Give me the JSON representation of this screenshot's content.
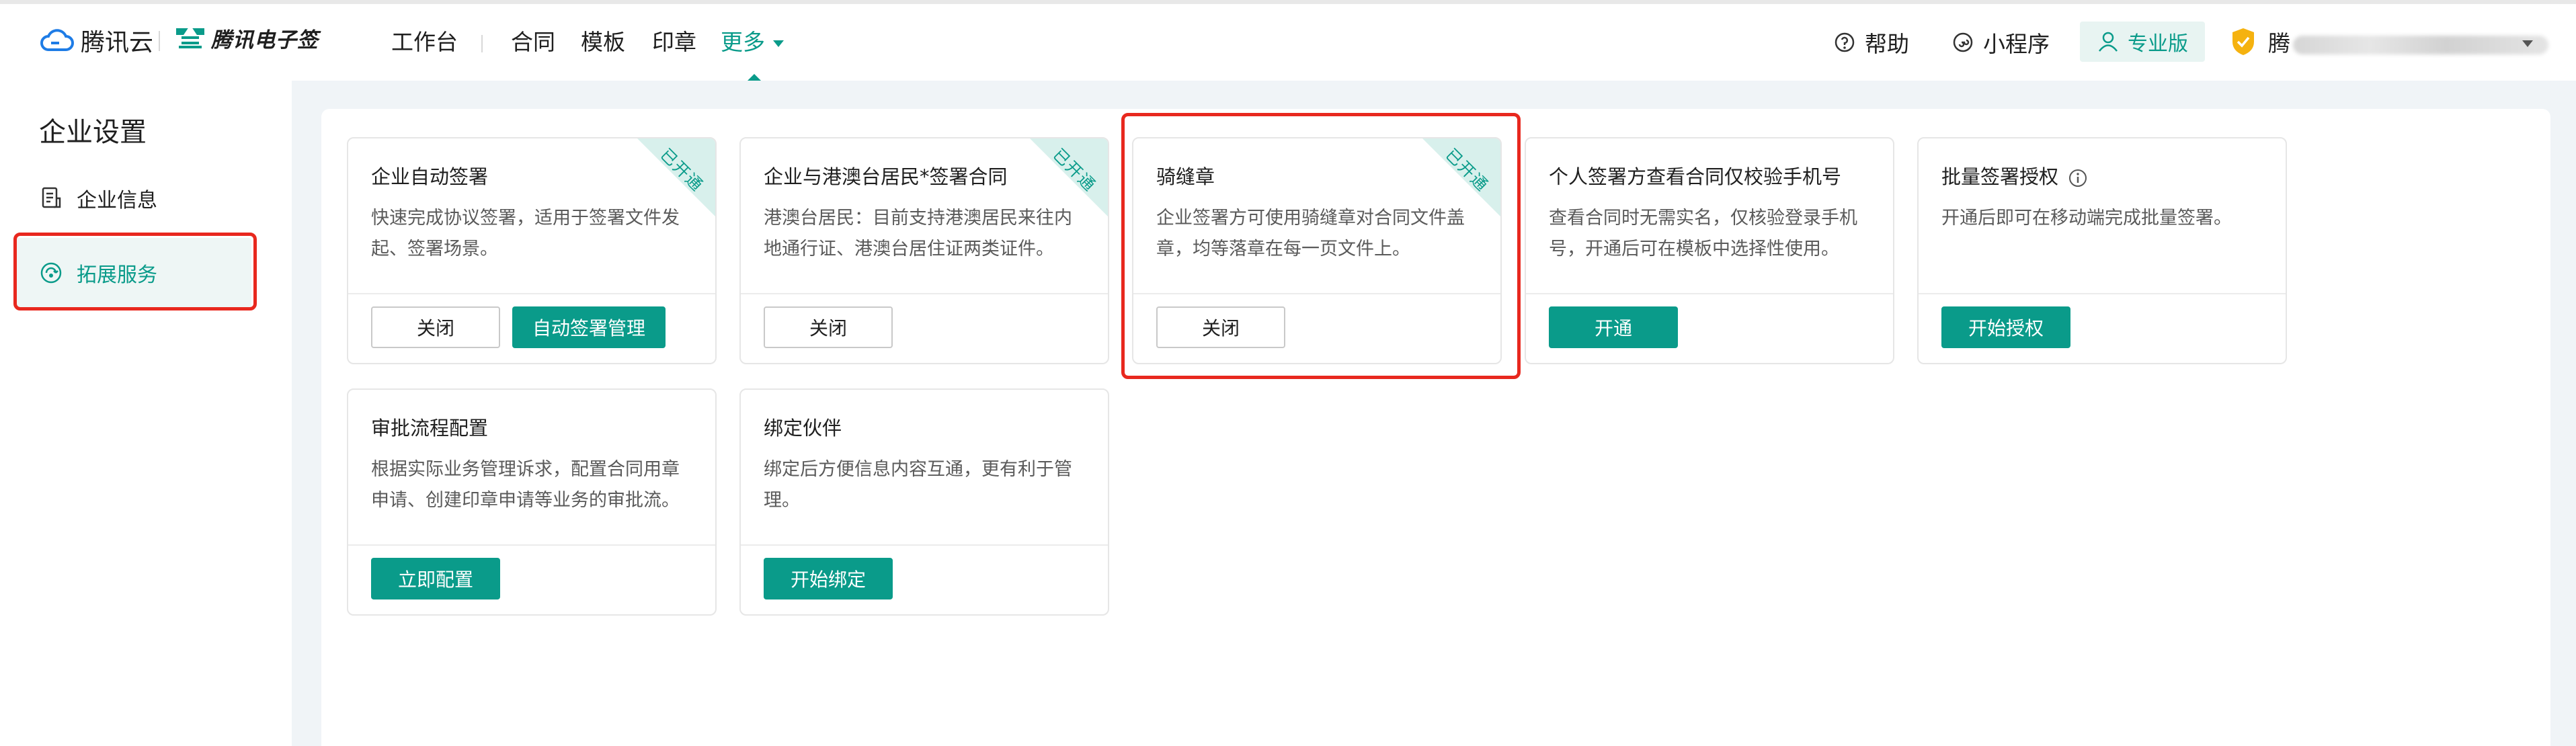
{
  "brand": {
    "tencent_cloud": "腾讯云",
    "esign": "腾讯电子签"
  },
  "nav": {
    "items": [
      "工作台",
      "合同",
      "模板",
      "印章"
    ],
    "more": "更多"
  },
  "header_right": {
    "help": "帮助",
    "mini_program": "小程序",
    "edition": "专业版",
    "user_prefix": "腾"
  },
  "sidebar": {
    "title": "企业设置",
    "items": [
      {
        "label": "企业信息",
        "icon": "document-icon"
      },
      {
        "label": "拓展服务",
        "icon": "extension-icon",
        "active": true
      }
    ]
  },
  "cards": [
    {
      "title": "企业自动签署",
      "desc": "快速完成协议签署，适用于签署文件发起、签署场景。",
      "ribbon": "已开通",
      "buttons": [
        "关闭",
        "自动签署管理"
      ]
    },
    {
      "title": "企业与港澳台居民*签署合同",
      "desc": "港澳台居民：目前支持港澳居民来往内地通行证、港澳台居住证两类证件。",
      "ribbon": "已开通",
      "buttons": [
        "关闭"
      ]
    },
    {
      "title": "骑缝章",
      "desc": "企业签署方可使用骑缝章对合同文件盖章，均等落章在每一页文件上。",
      "ribbon": "已开通",
      "buttons": [
        "关闭"
      ]
    },
    {
      "title": "个人签署方查看合同仅校验手机号",
      "desc": "查看合同时无需实名，仅核验登录手机号，开通后可在模板中选择性使用。",
      "buttons": [
        "开通"
      ]
    },
    {
      "title": "批量签署授权",
      "desc": "开通后即可在移动端完成批量签署。",
      "buttons": [
        "开始授权"
      ]
    },
    {
      "title": "审批流程配置",
      "desc": "根据实际业务管理诉求，配置合同用章申请、创建印章申请等业务的审批流。",
      "buttons": [
        "立即配置"
      ]
    },
    {
      "title": "绑定伙伴",
      "desc": "绑定后方便信息内容互通，更有利于管理。",
      "buttons": [
        "开始绑定"
      ]
    }
  ],
  "colors": {
    "accent": "#0a9b8a",
    "highlight": "#e8281e",
    "ribbon_bg": "#d8f0ec"
  }
}
